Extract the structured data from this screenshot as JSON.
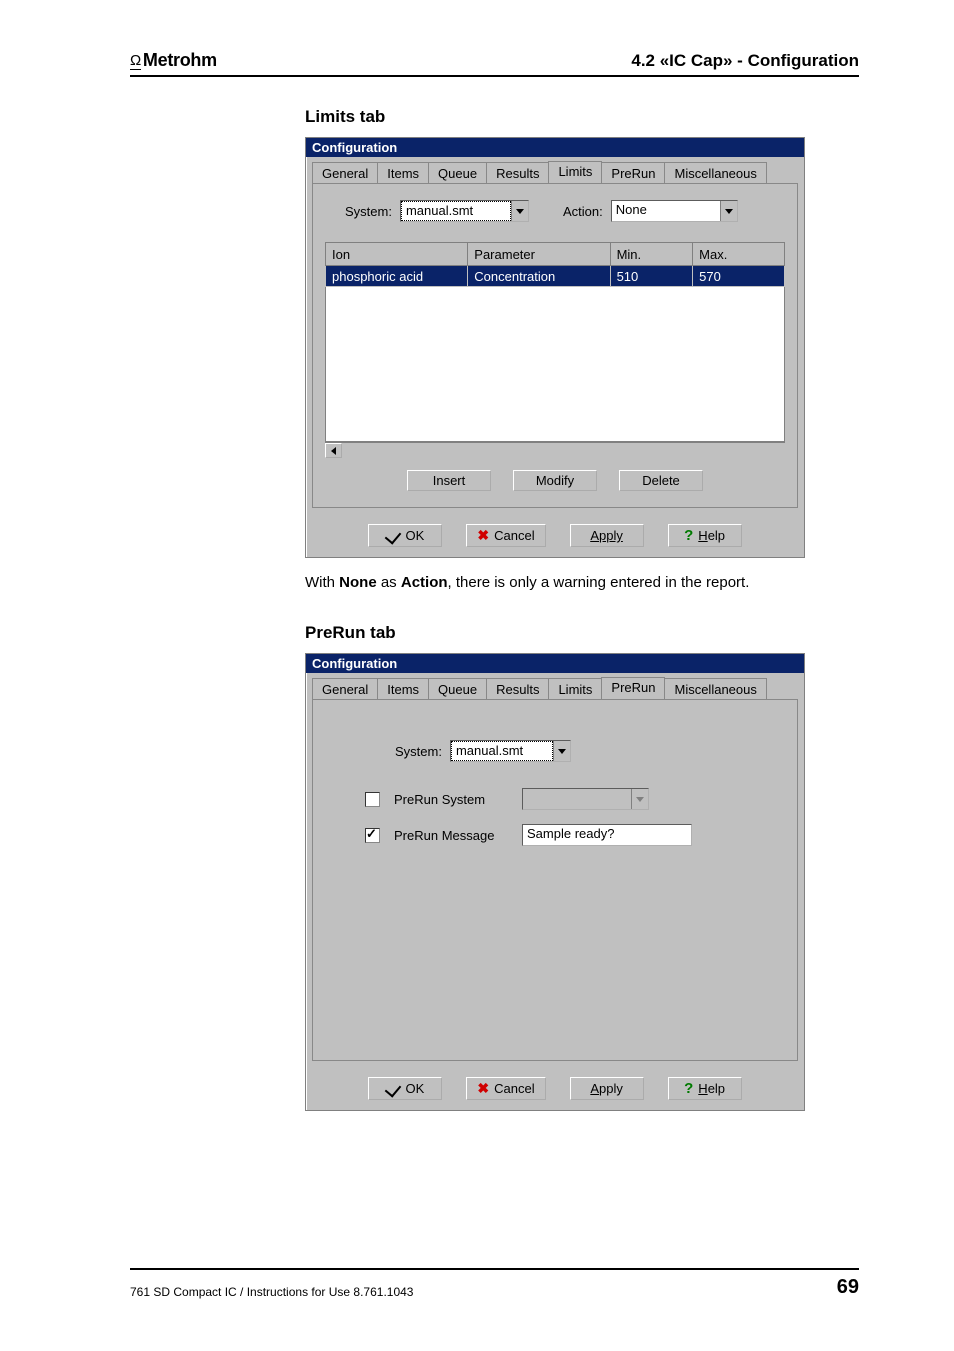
{
  "header": {
    "brand": "Metrohm",
    "chapter": "4.2 «IC Cap» - Configuration"
  },
  "footer": {
    "doc": "761 SD Compact IC / Instructions for Use  8.761.1043",
    "page": "69"
  },
  "section1": {
    "title": "Limits tab",
    "dialog_title": "Configuration",
    "tabs": [
      "General",
      "Items",
      "Queue",
      "Results",
      "Limits",
      "PreRun",
      "Miscellaneous"
    ],
    "active_tab": 4,
    "system_label": "System:",
    "system_value": "manual.smt",
    "action_label": "Action:",
    "action_value": "None",
    "table": {
      "headers": [
        "Ion",
        "Parameter",
        "Min.",
        "Max."
      ],
      "row": [
        "phosphoric acid",
        "Concentration",
        "510",
        "570"
      ]
    },
    "buttons_mid": {
      "insert": "Insert",
      "modify": "Modify",
      "delete": "Delete"
    },
    "buttons_bottom": {
      "ok": "OK",
      "cancel": "Cancel",
      "apply": "Apply",
      "help": "Help"
    },
    "caption_pre": "With ",
    "caption_b1": "None",
    "caption_mid": " as ",
    "caption_b2": "Action",
    "caption_post": ", there is only a warning entered in the report."
  },
  "section2": {
    "title": "PreRun tab",
    "dialog_title": "Configuration",
    "tabs": [
      "General",
      "Items",
      "Queue",
      "Results",
      "Limits",
      "PreRun",
      "Miscellaneous"
    ],
    "active_tab": 5,
    "system_label": "System:",
    "system_value": "manual.smt",
    "prerun_system_label": "PreRun System",
    "prerun_message_label": "PreRun Message",
    "prerun_message_value": "Sample ready?",
    "buttons_bottom": {
      "ok": "OK",
      "cancel": "Cancel",
      "apply": "Apply",
      "help": "Help"
    }
  }
}
